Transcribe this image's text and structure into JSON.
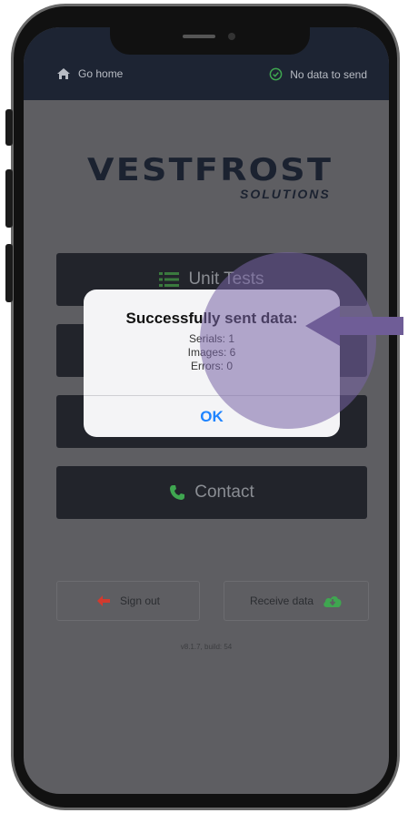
{
  "nav": {
    "home_label": "Go home",
    "status_label": "No data to send"
  },
  "logo": {
    "brand": "VESTFROST",
    "sub": "SOLUTIONS"
  },
  "menu": {
    "unit_tests_label": "Unit Tests",
    "contact_label": "Contact"
  },
  "footer": {
    "sign_out_label": "Sign out",
    "receive_data_label": "Receive data",
    "version": "v8.1.7, build: 54"
  },
  "dialog": {
    "title": "Successfully sent data:",
    "serials": "Serials: 1",
    "images": "Images: 6",
    "errors": "Errors: 0",
    "ok_label": "OK"
  },
  "colors": {
    "overlay": "#5e5e62",
    "topbar": "#1d2433",
    "button_dark": "#22242b",
    "highlight": "#7864a5",
    "link_blue": "#1f84ff",
    "contact_icon": "#3fa650",
    "sign_out_icon": "#d23a2e",
    "receive_icon": "#3fa650"
  },
  "icons": {
    "home": "home-icon",
    "status": "check-circle-icon",
    "unit_tests": "list-icon",
    "contact": "phone-icon",
    "sign_out": "arrow-left-icon",
    "receive": "cloud-download-icon",
    "pointer": "arrow-left-pointer-icon"
  }
}
